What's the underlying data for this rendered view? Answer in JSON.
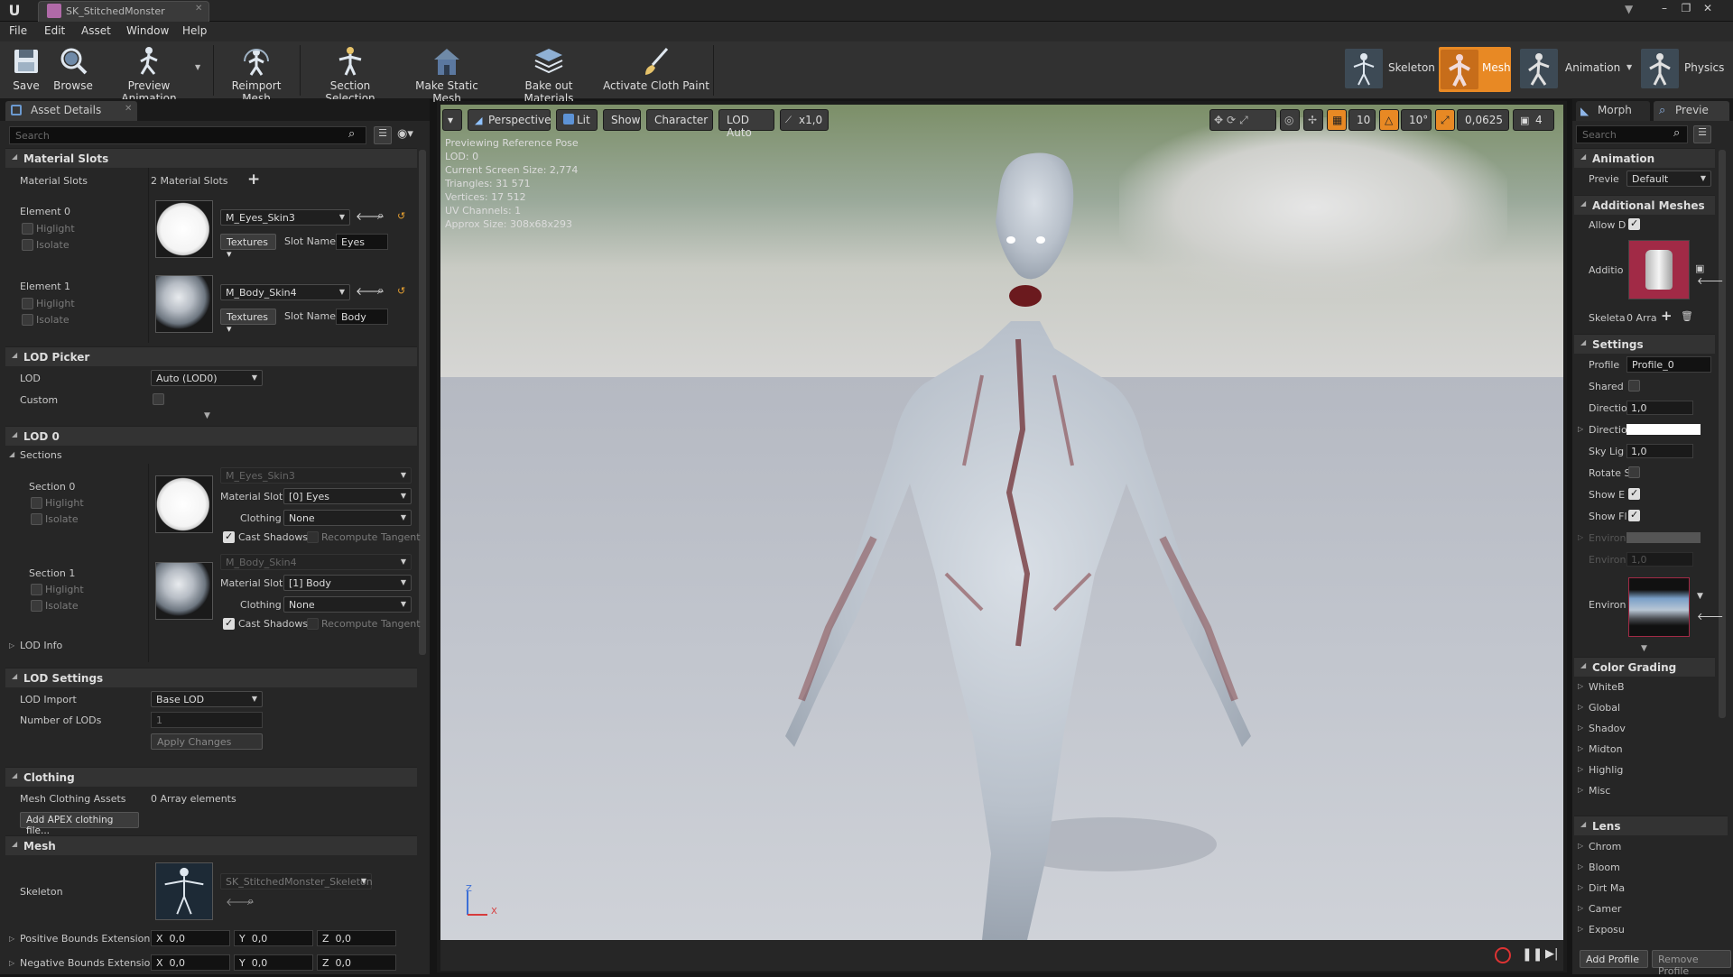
{
  "window": {
    "tab_title": "SK_StitchedMonster",
    "logo": "U"
  },
  "menu": [
    "File",
    "Edit",
    "Asset",
    "Window",
    "Help"
  ],
  "toolbar": {
    "buttons": [
      "Save",
      "Browse",
      "Preview Animation",
      "Reimport Mesh",
      "Section Selection",
      "Make Static Mesh",
      "Bake out Materials",
      "Activate Cloth Paint"
    ],
    "modes": [
      "Skeleton",
      "Mesh",
      "Animation",
      "Physics"
    ],
    "active_mode": "Mesh"
  },
  "asset_details": {
    "tab": "Asset Details",
    "search_placeholder": "Search",
    "material_slots": {
      "header": "Material Slots",
      "label": "Material Slots",
      "count": "2 Material Slots",
      "elements": [
        {
          "label": "Element 0",
          "material": "M_Eyes_Skin3",
          "textures": "Textures",
          "slot_name_label": "Slot Name",
          "slot_name": "Eyes",
          "highlight": "Higlight",
          "isolate": "Isolate"
        },
        {
          "label": "Element 1",
          "material": "M_Body_Skin4",
          "textures": "Textures",
          "slot_name_label": "Slot Name",
          "slot_name": "Body",
          "highlight": "Higlight",
          "isolate": "Isolate"
        }
      ]
    },
    "lod_picker": {
      "header": "LOD Picker",
      "lod_label": "LOD",
      "lod_value": "Auto (LOD0)",
      "custom_label": "Custom"
    },
    "lod0": {
      "header": "LOD 0",
      "sections_label": "Sections",
      "sections": [
        {
          "label": "Section 0",
          "material": "M_Eyes_Skin3",
          "material_slot_label": "Material Slot",
          "material_slot": "[0] Eyes",
          "clothing_label": "Clothing",
          "clothing": "None",
          "cast_shadows": "Cast Shadows",
          "recompute": "Recompute Tangent",
          "highlight": "Higlight",
          "isolate": "Isolate"
        },
        {
          "label": "Section 1",
          "material": "M_Body_Skin4",
          "material_slot_label": "Material Slot",
          "material_slot": "[1] Body",
          "clothing_label": "Clothing",
          "clothing": "None",
          "cast_shadows": "Cast Shadows",
          "recompute": "Recompute Tangent",
          "highlight": "Higlight",
          "isolate": "Isolate"
        }
      ],
      "lod_info": "LOD Info"
    },
    "lod_settings": {
      "header": "LOD Settings",
      "lod_import_label": "LOD Import",
      "lod_import": "Base LOD",
      "num_lods_label": "Number of LODs",
      "num_lods": "1",
      "apply": "Apply Changes"
    },
    "clothing": {
      "header": "Clothing",
      "assets_label": "Mesh Clothing Assets",
      "assets_value": "0 Array elements",
      "add_button": "Add APEX clothing file..."
    },
    "mesh": {
      "header": "Mesh",
      "skeleton_label": "Skeleton",
      "skeleton": "SK_StitchedMonster_Skeleton",
      "pos_bounds_label": "Positive Bounds Extension",
      "neg_bounds_label": "Negative Bounds Extension",
      "axes": [
        "X",
        "Y",
        "Z"
      ],
      "bounds_value": "0,0"
    }
  },
  "viewport": {
    "buttons": [
      "Perspective",
      "Lit",
      "Show",
      "Character",
      "LOD Auto",
      "x1,0"
    ],
    "info": [
      "Previewing Reference Pose",
      "LOD: 0",
      "Current Screen Size: 2,774",
      "Triangles: 31 571",
      "Vertices: 17 512",
      "UV Channels: 1",
      "Approx Size: 308x68x293"
    ],
    "snap_values": [
      "10",
      "10°",
      "0,0625",
      "4"
    ],
    "axis_z": "Z",
    "axis_x": "X"
  },
  "preview_settings": {
    "tabs": [
      "Morph",
      "Previe"
    ],
    "search_placeholder": "Search",
    "animation": {
      "header": "Animation",
      "label": "Previe",
      "value": "Default"
    },
    "additional_meshes": {
      "header": "Additional Meshes",
      "allow_label": "Allow D",
      "addition_label": "Additio",
      "skeleta_label": "Skeleta",
      "skeleta_value": "0 Arra"
    },
    "settings": {
      "header": "Settings",
      "profile_label": "Profile",
      "profile_value": "Profile_0",
      "shared_label": "Shared",
      "direction1_label": "Directio",
      "direction1_value": "1,0",
      "direction2_label": "Directio",
      "skylight_label": "Sky Lig",
      "skylight_value": "1,0",
      "rotate_label": "Rotate S",
      "show_env_label": "Show E",
      "show_floor_label": "Show Fl",
      "environ1_label": "Environ",
      "environ2_label": "Environ",
      "environ2_value": "1,0",
      "environ3_label": "Environ"
    },
    "color_grading": {
      "header": "Color Grading",
      "items": [
        "WhiteB",
        "Global",
        "Shadov",
        "Midton",
        "Highlig",
        "Misc"
      ]
    },
    "lens": {
      "header": "Lens",
      "items": [
        "Chrom",
        "Bloom",
        "Dirt Ma",
        "Camer",
        "Exposu"
      ]
    },
    "footer": {
      "add": "Add Profile",
      "remove": "Remove Profile"
    }
  }
}
